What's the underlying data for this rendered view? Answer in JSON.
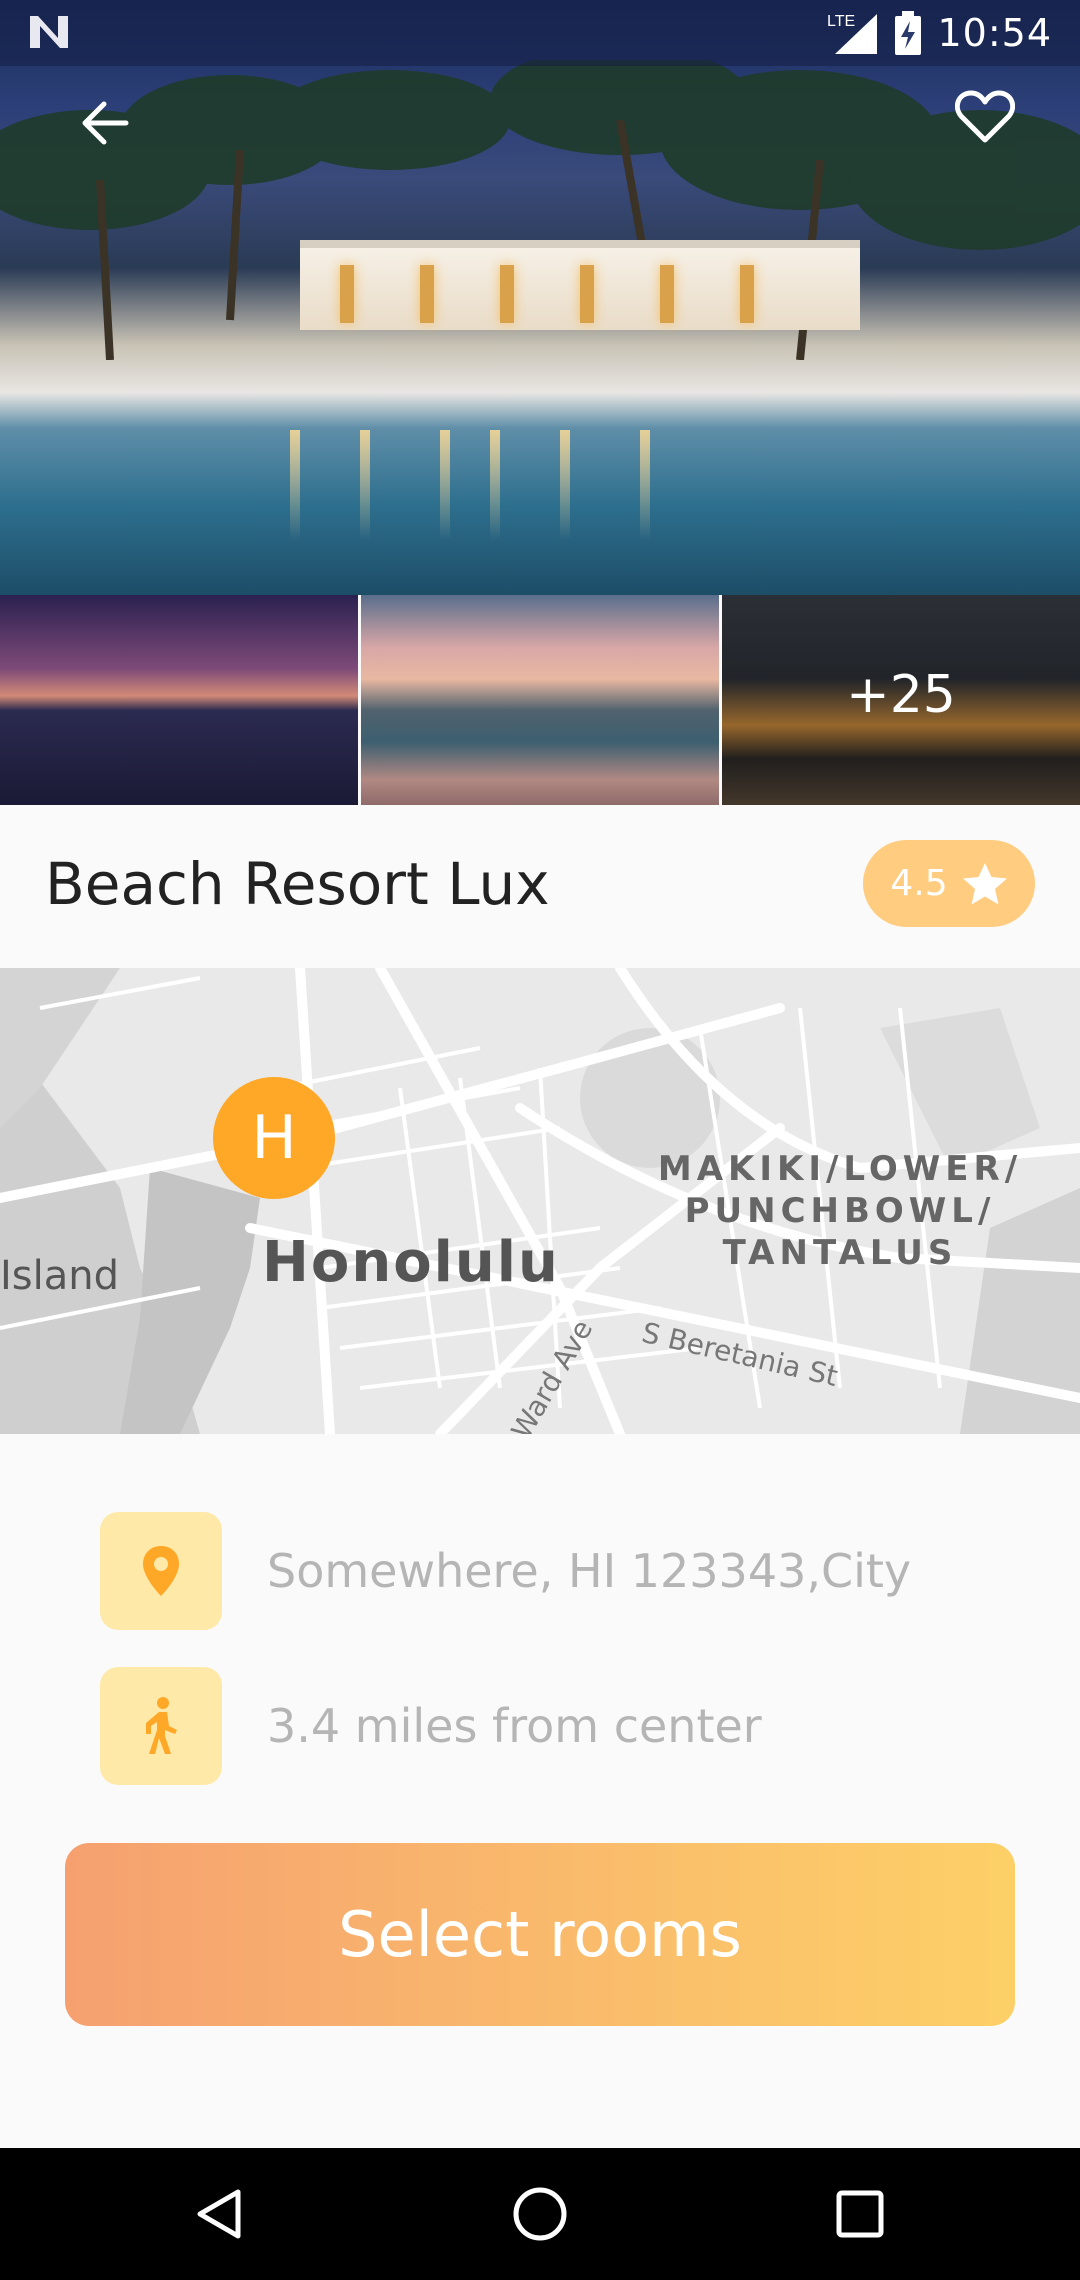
{
  "status_bar": {
    "time": "10:54",
    "network": "LTE",
    "icons": [
      "app-notification-icon",
      "signal-icon",
      "battery-charging-icon"
    ]
  },
  "hotel": {
    "name": "Beach Resort Lux",
    "rating": "4.5",
    "more_photos_label": "+25"
  },
  "map": {
    "labels": {
      "city": "Honolulu",
      "district_line1": "MAKIKI/LOWER/",
      "district_line2": "PUNCHBOWL/",
      "district_line3": "TANTALUS",
      "island": "Island",
      "street1": "S Beretania St",
      "street2": "Ward Ave"
    },
    "marker_label": "H"
  },
  "details": {
    "address": "Somewhere, HI 123343,City",
    "distance": "3.4 miles from center"
  },
  "actions": {
    "select_rooms": "Select rooms"
  },
  "colors": {
    "accent": "#ffa726",
    "rating_bg": "#ffcc80",
    "icon_bg": "#ffe9a8",
    "cta_start": "#f6a070",
    "cta_end": "#fdd067"
  }
}
